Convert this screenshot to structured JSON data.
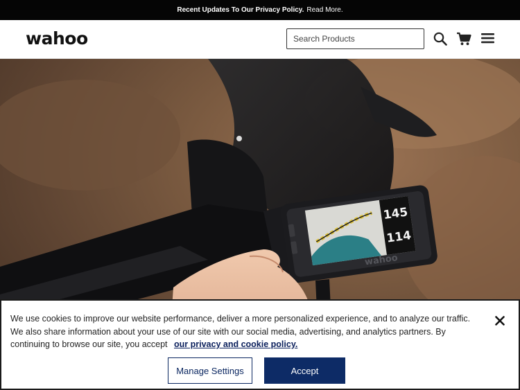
{
  "promo": {
    "strong_text": "Recent Updates To Our Privacy Policy.",
    "link_text": "Read More."
  },
  "header": {
    "logo": "wahoo",
    "search_placeholder": "Search Products",
    "icons": [
      "search-icon",
      "cart-icon",
      "menu-icon"
    ]
  },
  "hero": {
    "device_readouts": [
      "145",
      "114"
    ],
    "device_brand": "wahoo"
  },
  "cookie": {
    "message": "We use cookies to improve our website performance, deliver a more personalized experience, and to analyze our traffic. We also share information about your use of our site with our social media, advertising, and analytics partners. By continuing to browse our site, you accept",
    "link_text": "our privacy and cookie policy.",
    "manage_label": "Manage Settings",
    "accept_label": "Accept",
    "close_icon": "close-icon"
  },
  "colors": {
    "brand_navy": "#0d2b66",
    "promo_bg": "#050505"
  }
}
